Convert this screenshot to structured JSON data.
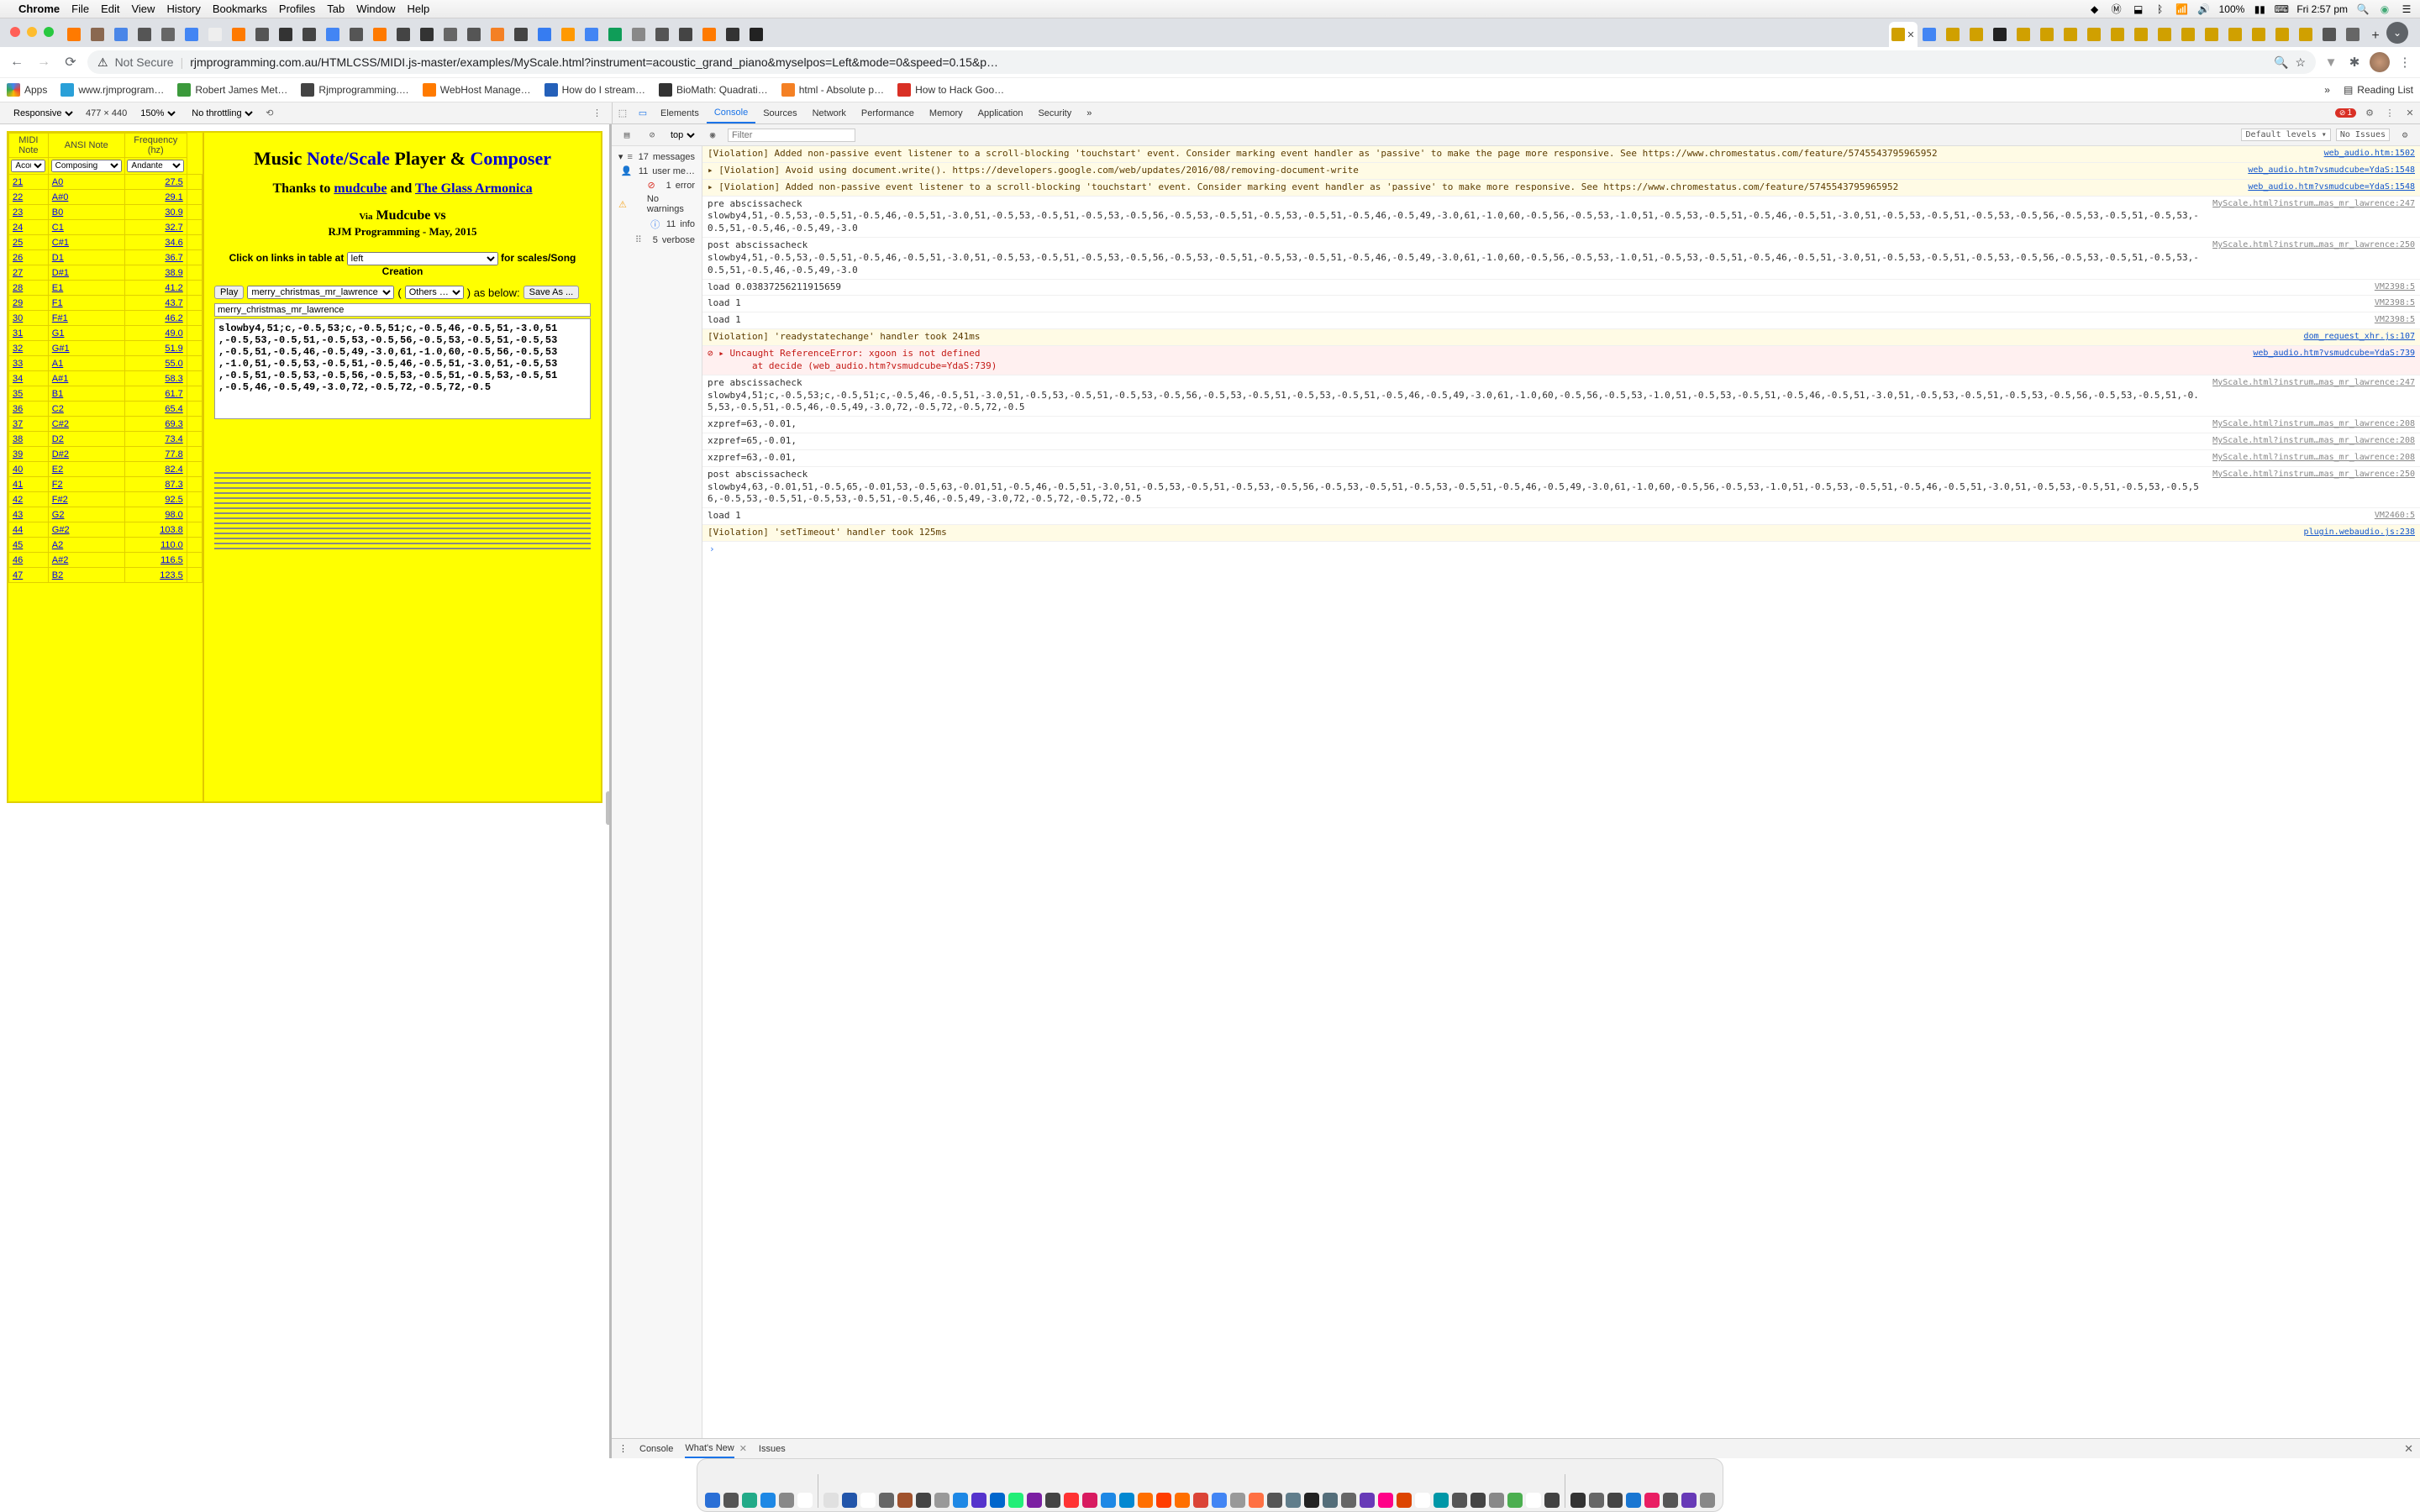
{
  "menubar": {
    "app": "Chrome",
    "items": [
      "File",
      "Edit",
      "View",
      "History",
      "Bookmarks",
      "Profiles",
      "Tab",
      "Window",
      "Help"
    ],
    "battery": "100%",
    "clock": "Fri 2:57 pm"
  },
  "chrome": {
    "not_secure": "Not Secure",
    "url": "rjmprogramming.com.au/HTMLCSS/MIDI.js-master/examples/MyScale.html?instrument=acoustic_grand_piano&myselpos=Left&mode=0&speed=0.15&p…",
    "bookmarks": [
      {
        "label": "Apps",
        "color": "#eee"
      },
      {
        "label": "www.rjmprogram…",
        "color": "#2aa0d8"
      },
      {
        "label": "Robert James Met…",
        "color": "#3c9a3c"
      },
      {
        "label": "Rjmprogramming.…",
        "color": "#444"
      },
      {
        "label": "WebHost Manage…",
        "color": "#ff7a00"
      },
      {
        "label": "How do I stream…",
        "color": "#2460b9"
      },
      {
        "label": "BioMath: Quadrati…",
        "color": "#333"
      },
      {
        "label": "html - Absolute p…",
        "color": "#f48024"
      },
      {
        "label": "How to Hack Goo…",
        "color": "#d93025"
      }
    ],
    "reading_list": "Reading List",
    "more": "»"
  },
  "dt_ribbon": {
    "device": "Responsive",
    "w": "477",
    "h": "440",
    "zoom": "150%",
    "throttle": "No throttling",
    "tabs": [
      "Elements",
      "Console",
      "Sources",
      "Network",
      "Performance",
      "Memory",
      "Application",
      "Security"
    ],
    "active_tab": "Console",
    "errors": "1",
    "more": "»"
  },
  "page": {
    "midi_hdr": "MIDI Note",
    "ansi_hdr": "ANSI Note",
    "freq_hdr1": "Frequency",
    "freq_hdr2": "(hz)",
    "instr_sel": "Acoustic Grand Piano",
    "mode_sel": "Composing",
    "tempo_sel": "Andante",
    "rows": [
      {
        "n": "21",
        "note": "A0",
        "freq": "27.5"
      },
      {
        "n": "22",
        "note": "A#0",
        "freq": "29.1"
      },
      {
        "n": "23",
        "note": "B0",
        "freq": "30.9"
      },
      {
        "n": "24",
        "note": "C1",
        "freq": "32.7"
      },
      {
        "n": "25",
        "note": "C#1",
        "freq": "34.6"
      },
      {
        "n": "26",
        "note": "D1",
        "freq": "36.7"
      },
      {
        "n": "27",
        "note": "D#1",
        "freq": "38.9"
      },
      {
        "n": "28",
        "note": "E1",
        "freq": "41.2"
      },
      {
        "n": "29",
        "note": "F1",
        "freq": "43.7"
      },
      {
        "n": "30",
        "note": "F#1",
        "freq": "46.2"
      },
      {
        "n": "31",
        "note": "G1",
        "freq": "49.0"
      },
      {
        "n": "32",
        "note": "G#1",
        "freq": "51.9"
      },
      {
        "n": "33",
        "note": "A1",
        "freq": "55.0"
      },
      {
        "n": "34",
        "note": "A#1",
        "freq": "58.3"
      },
      {
        "n": "35",
        "note": "B1",
        "freq": "61.7"
      },
      {
        "n": "36",
        "note": "C2",
        "freq": "65.4"
      },
      {
        "n": "37",
        "note": "C#2",
        "freq": "69.3"
      },
      {
        "n": "38",
        "note": "D2",
        "freq": "73.4"
      },
      {
        "n": "39",
        "note": "D#2",
        "freq": "77.8"
      },
      {
        "n": "40",
        "note": "E2",
        "freq": "82.4"
      },
      {
        "n": "41",
        "note": "F2",
        "freq": "87.3"
      },
      {
        "n": "42",
        "note": "F#2",
        "freq": "92.5"
      },
      {
        "n": "43",
        "note": "G2",
        "freq": "98.0"
      },
      {
        "n": "44",
        "note": "G#2",
        "freq": "103.8"
      },
      {
        "n": "45",
        "note": "A2",
        "freq": "110.0"
      },
      {
        "n": "46",
        "note": "A#2",
        "freq": "116.5"
      },
      {
        "n": "47",
        "note": "B2",
        "freq": "123.5"
      }
    ],
    "title_music": "Music",
    "title_note": "Note/Scale",
    "title_player": "Player &",
    "title_composer": "Composer",
    "thanks_pre": "Thanks to ",
    "thanks_mudcube": "mudcube",
    "thanks_and": " and ",
    "thanks_glass": "The Glass Armonica",
    "via": "Via",
    "mudcube_vs": "Mudcube vs",
    "rjm": "RJM Programming - May, 2015",
    "click_pre": "Click on links in table at ",
    "pos_sel": "left",
    "click_post": " for scales/Song Creation",
    "play": "Play",
    "song_sel": "merry_christmas_mr_lawrence",
    "others": "Others …",
    "as_below": ") as below:",
    "save_as": "Save As ...",
    "song_name": "merry_christmas_mr_lawrence",
    "song_data": "slowby4,51;c,-0.5,53;c,-0.5,51;c,-0.5,46,-0.5,51,-3.0,51\n,-0.5,53,-0.5,51,-0.5,53,-0.5,56,-0.5,53,-0.5,51,-0.5,53\n,-0.5,51,-0.5,46,-0.5,49,-3.0,61,-1.0,60,-0.5,56,-0.5,53\n,-1.0,51,-0.5,53,-0.5,51,-0.5,46,-0.5,51,-3.0,51,-0.5,53\n,-0.5,51,-0.5,53,-0.5,56,-0.5,53,-0.5,51,-0.5,53,-0.5,51\n,-0.5,46,-0.5,49,-3.0,72,-0.5,72,-0.5,72,-0.5"
  },
  "console": {
    "top": "top",
    "filter_ph": "Filter",
    "levels": "Default levels",
    "issues": "No Issues",
    "side": [
      {
        "icon": "≡",
        "cnt": "17",
        "label": "messages",
        "color": "#666"
      },
      {
        "icon": "👤",
        "cnt": "11",
        "label": "user me…",
        "color": "#666"
      },
      {
        "icon": "⊘",
        "cnt": "1",
        "label": "error",
        "color": "#d93025"
      },
      {
        "icon": "⚠",
        "cnt": "",
        "label": "No warnings",
        "color": "#f5a623"
      },
      {
        "icon": "ⓘ",
        "cnt": "11",
        "label": "info",
        "color": "#367cf1"
      },
      {
        "icon": "⠿",
        "cnt": "5",
        "label": "verbose",
        "color": "#888"
      }
    ],
    "messages": [
      {
        "cls": "warn",
        "txt": "[Violation] Added non-passive event listener to a scroll-blocking 'touchstart' event. Consider marking event handler as 'passive' to make the page more responsive. See https://www.chromestatus.com/feature/5745543795965952",
        "src": "web_audio.htm:1502"
      },
      {
        "cls": "warn",
        "txt": "▸ [Violation] Avoid using document.write(). https://developers.google.com/web/updates/2016/08/removing-document-write",
        "src": "web_audio.htm?vsmudcube=YdaS:1548"
      },
      {
        "cls": "warn",
        "txt": "▸ [Violation] Added non-passive event listener to a scroll-blocking 'touchstart' event. Consider marking event handler as 'passive' to make more responsive. See https://www.chromestatus.com/feature/5745543795965952",
        "src": "web_audio.htm?vsmudcube=YdaS:1548"
      },
      {
        "cls": "info",
        "txt": "pre abscissacheck\nslowby4,51,-0.5,53,-0.5,51,-0.5,46,-0.5,51,-3.0,51,-0.5,53,-0.5,51,-0.5,53,-0.5,56,-0.5,53,-0.5,51,-0.5,53,-0.5,51,-0.5,46,-0.5,49,-3.0,61,-1.0,60,-0.5,56,-0.5,53,-1.0,51,-0.5,53,-0.5,51,-0.5,46,-0.5,51,-3.0,51,-0.5,53,-0.5,51,-0.5,53,-0.5,56,-0.5,53,-0.5,51,-0.5,53,-0.5,51,-0.5,46,-0.5,49,-3.0",
        "src": "MyScale.html?instrum…mas_mr_lawrence:247"
      },
      {
        "cls": "info",
        "txt": "post abscissacheck\nslowby4,51,-0.5,53,-0.5,51,-0.5,46,-0.5,51,-3.0,51,-0.5,53,-0.5,51,-0.5,53,-0.5,56,-0.5,53,-0.5,51,-0.5,53,-0.5,51,-0.5,46,-0.5,49,-3.0,61,-1.0,60,-0.5,56,-0.5,53,-1.0,51,-0.5,53,-0.5,51,-0.5,46,-0.5,51,-3.0,51,-0.5,53,-0.5,51,-0.5,53,-0.5,56,-0.5,53,-0.5,51,-0.5,53,-0.5,51,-0.5,46,-0.5,49,-3.0",
        "src": "MyScale.html?instrum…mas_mr_lawrence:250"
      },
      {
        "cls": "info",
        "txt": "load 0.03837256211915659",
        "src": "VM2398:5"
      },
      {
        "cls": "info",
        "txt": "load 1",
        "src": "VM2398:5"
      },
      {
        "cls": "info",
        "txt": "load 1",
        "src": "VM2398:5"
      },
      {
        "cls": "warn",
        "txt": "[Violation] 'readystatechange' handler took 241ms",
        "src": "dom_request_xhr.js:107"
      },
      {
        "cls": "err",
        "txt": "⊘ ▸ Uncaught ReferenceError: xgoon is not defined\n        at decide (web_audio.htm?vsmudcube=YdaS:739)",
        "src": "web_audio.htm?vsmudcube=YdaS:739"
      },
      {
        "cls": "info",
        "txt": "pre abscissacheck\nslowby4,51;c,-0.5,53;c,-0.5,51;c,-0.5,46,-0.5,51,-3.0,51,-0.5,53,-0.5,51,-0.5,53,-0.5,56,-0.5,53,-0.5,51,-0.5,53,-0.5,51,-0.5,46,-0.5,49,-3.0,61,-1.0,60,-0.5,56,-0.5,53,-1.0,51,-0.5,53,-0.5,51,-0.5,46,-0.5,51,-3.0,51,-0.5,53,-0.5,51,-0.5,53,-0.5,56,-0.5,53,-0.5,51,-0.5,53,-0.5,51,-0.5,46,-0.5,49,-3.0,72,-0.5,72,-0.5,72,-0.5",
        "src": "MyScale.html?instrum…mas_mr_lawrence:247"
      },
      {
        "cls": "info",
        "txt": "xzpref=63,-0.01,",
        "src": "MyScale.html?instrum…mas_mr_lawrence:208"
      },
      {
        "cls": "info",
        "txt": "xzpref=65,-0.01,",
        "src": "MyScale.html?instrum…mas_mr_lawrence:208"
      },
      {
        "cls": "info",
        "txt": "xzpref=63,-0.01,",
        "src": "MyScale.html?instrum…mas_mr_lawrence:208"
      },
      {
        "cls": "info",
        "txt": "post abscissacheck\nslowby4,63,-0.01,51,-0.5,65,-0.01,53,-0.5,63,-0.01,51,-0.5,46,-0.5,51,-3.0,51,-0.5,53,-0.5,51,-0.5,53,-0.5,56,-0.5,53,-0.5,51,-0.5,53,-0.5,51,-0.5,46,-0.5,49,-3.0,61,-1.0,60,-0.5,56,-0.5,53,-1.0,51,-0.5,53,-0.5,51,-0.5,46,-0.5,51,-3.0,51,-0.5,53,-0.5,51,-0.5,53,-0.5,56,-0.5,53,-0.5,51,-0.5,53,-0.5,51,-0.5,46,-0.5,49,-3.0,72,-0.5,72,-0.5,72,-0.5",
        "src": "MyScale.html?instrum…mas_mr_lawrence:250"
      },
      {
        "cls": "info",
        "txt": "load 1",
        "src": "VM2460:5"
      },
      {
        "cls": "warn",
        "txt": "[Violation] 'setTimeout' handler took 125ms",
        "src": "plugin.webaudio.js:238"
      }
    ],
    "drawer": {
      "console": "Console",
      "whatsnew": "What's New",
      "issues": "Issues"
    }
  },
  "tabs_favicons": [
    "#ff7a00",
    "#8a6850",
    "#4a86e8",
    "#555",
    "#666",
    "#4285f4",
    "#eee",
    "#ff7a00",
    "#555",
    "#333",
    "#444",
    "#4285f4",
    "#555",
    "#ff7a00",
    "#444",
    "#333",
    "#666",
    "#555",
    "#f48024",
    "#444",
    "#367cf1",
    "#f90",
    "#4285f4",
    "#0f9d58",
    "#888",
    "#555",
    "#444",
    "#ff7a00",
    "#333",
    "#222"
  ],
  "tabs_after": [
    "#4285f4",
    "#d0a000",
    "#d0a000",
    "#222",
    "#d0a000",
    "#d0a000",
    "#d0a000",
    "#d0a000",
    "#d0a000",
    "#d0a000",
    "#d0a000",
    "#d0a000",
    "#d0a000",
    "#d0a000",
    "#d0a000",
    "#d0a000",
    "#d0a000",
    "#555",
    "#666"
  ],
  "dock_colors": [
    "#2a6fd6",
    "#555",
    "#2a8",
    "#1e88e5",
    "#888",
    "#fff",
    "#e0e0e0",
    "#25a",
    "#fff",
    "#666",
    "#a0522d",
    "#444",
    "#999",
    "#1e88e5",
    "#53c",
    "#06c",
    "#2e7",
    "#7b1fa2",
    "#444",
    "#f33",
    "#d81b60",
    "#1e88e5",
    "#0288d1",
    "#ff6f00",
    "#ff3d00",
    "#ff6f00",
    "#db4437",
    "#4285f4",
    "#999",
    "#ff7043",
    "#555",
    "#607d8b",
    "#222",
    "#546e7a",
    "#666",
    "#673ab7",
    "#ff0188",
    "#d40",
    "#fff",
    "#0097a7",
    "#555",
    "#444",
    "#888",
    "#4caf50",
    "#ffffff",
    "#424242",
    "#333",
    "#666",
    "#444",
    "#1976d2",
    "#e91e63",
    "#555",
    "#673ab7",
    "#888"
  ]
}
